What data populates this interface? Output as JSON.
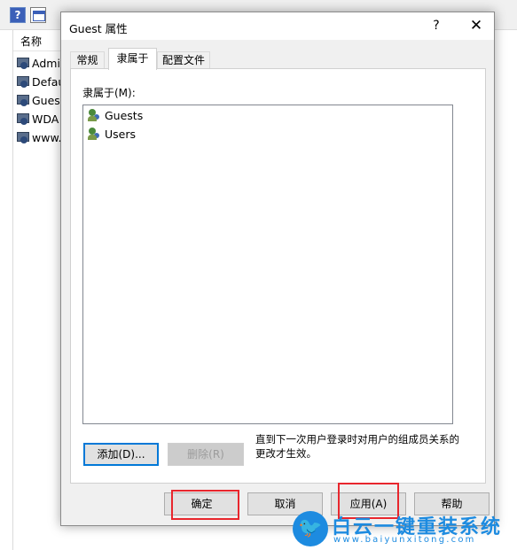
{
  "toolbar": {
    "help_icon_glyph": "?"
  },
  "list": {
    "column_header": "名称",
    "rows": [
      "Admi",
      "Defau",
      "Gues",
      "WDA",
      "www."
    ]
  },
  "dialog": {
    "title": "Guest 属性",
    "help_glyph": "?",
    "close_glyph": "✕",
    "tabs": [
      {
        "label": "常规",
        "active": false
      },
      {
        "label": "隶属于",
        "active": true
      },
      {
        "label": "配置文件",
        "active": false
      }
    ],
    "member_label": "隶属于(M):",
    "members": [
      "Guests",
      "Users"
    ],
    "add_label": "添加(D)...",
    "remove_label": "删除(R)",
    "note": "直到下一次用户登录时对用户的组成员关系的更改才生效。",
    "ok_label": "确定",
    "cancel_label": "取消",
    "apply_label": "应用(A)",
    "help_label": "帮助"
  },
  "watermark": {
    "icon_glyph": "🐦",
    "title": "白云一键重装系统",
    "url": "www.baiyunxitong.com"
  },
  "colors": {
    "accent": "#0078d7",
    "highlight": "#e8262d",
    "watermark": "#1d8be0"
  }
}
